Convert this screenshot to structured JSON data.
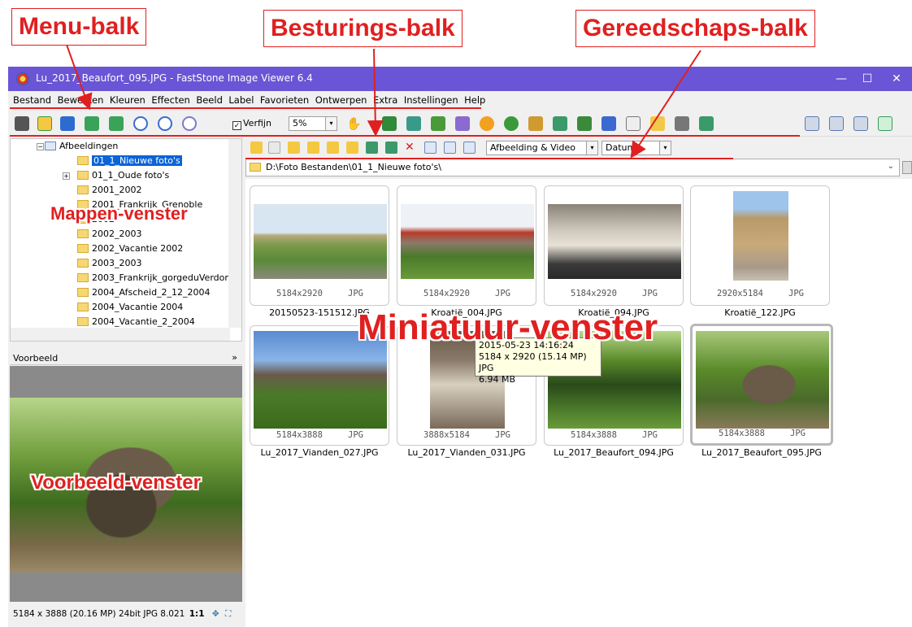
{
  "callouts": {
    "menu_balk": "Menu-balk",
    "besturings_balk": "Besturings-balk",
    "gereedschaps_balk": "Gereedschaps-balk",
    "mappen_venster": "Mappen-venster",
    "miniatuur_venster": "Miniatuur-venster",
    "voorbeeld_venster": "Voorbeeld-venster"
  },
  "titlebar": {
    "title": "Lu_2017_Beaufort_095.JPG  -  FastStone Image Viewer 6.4",
    "minimize": "—",
    "maximize": "☐",
    "close": "✕"
  },
  "menu": [
    "Bestand",
    "Bewerken",
    "Kleuren",
    "Effecten",
    "Beeld",
    "Label",
    "Favorieten",
    "Ontwerpen",
    "Extra",
    "Instellingen",
    "Help"
  ],
  "toolbar": {
    "refine_label": "Verfijn",
    "refine_checked": "✓",
    "zoom_value": "5%",
    "dropdown_arrow": "▾"
  },
  "folder_tree": {
    "root": "Afbeeldingen",
    "items": [
      "01_1_Nieuwe foto's",
      "01_1_Oude foto's",
      "2001_2002",
      "2001_Frankrijk_Grenoble",
      "2002",
      "2002_2003",
      "2002_Vacantie 2002",
      "2003_2003",
      "2003_Frankrijk_gorgeduVerdon",
      "2004_Afscheid_2_12_2004",
      "2004_Vacantie 2004",
      "2004_Vacantie_2_2004"
    ]
  },
  "preview": {
    "header": "Voorbeeld",
    "collapse": "»",
    "status": "5184 x 3888 (20.16 MP)  24bit  JPG  8.021",
    "ratio": "1:1"
  },
  "nav": {
    "filter_value": "Afbeelding & Video",
    "sort_value": "Datum",
    "path": "D:\\Foto Bestanden\\01_1_Nieuwe foto's\\",
    "path_chevron": "⌄"
  },
  "thumbnails": [
    {
      "name": "20150523-151512.JPG",
      "dims": "5184x2920",
      "format": "JPG"
    },
    {
      "name": "Kroatië_004.JPG",
      "dims": "5184x2920",
      "format": "JPG"
    },
    {
      "name": "Kroatië_094.JPG",
      "dims": "5184x2920",
      "format": "JPG"
    },
    {
      "name": "Kroatië_122.JPG",
      "dims": "2920x5184",
      "format": "JPG"
    },
    {
      "name": "Lu_2017_Vianden_027.JPG",
      "dims": "5184x3888",
      "format": "JPG"
    },
    {
      "name": "Lu_2017_Vianden_031.JPG",
      "dims": "3888x5184",
      "format": "JPG"
    },
    {
      "name": "Lu_2017_Beaufort_094.JPG",
      "dims": "5184x3888",
      "format": "JPG"
    },
    {
      "name": "Lu_2017_Beaufort_095.JPG",
      "dims": "5184x3888",
      "format": "JPG"
    }
  ],
  "tooltip": {
    "line1": "2015-05-23 14:16:24",
    "line2": "5184 x 2920 (15.14 MP)  JPG",
    "line3": "6.94 MB"
  },
  "colors": {
    "callout_red": "#e02020",
    "titlebar": "#6a55d6",
    "selection": "#0a64d8"
  }
}
